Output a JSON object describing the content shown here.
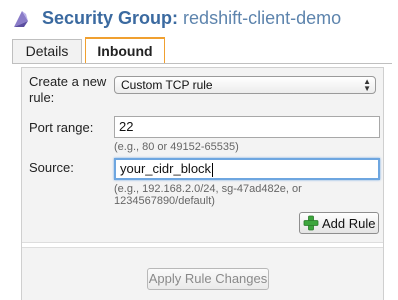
{
  "header": {
    "label": "Security Group:",
    "group_name": "redshift-client-demo",
    "logo_icon": "purple-crystal-icon"
  },
  "tabs": [
    {
      "label": "Details",
      "active": false
    },
    {
      "label": "Inbound",
      "active": true
    }
  ],
  "form": {
    "rule_label": "Create a new rule:",
    "rule_select_value": "Custom TCP rule",
    "port_label": "Port range:",
    "port_value": "22",
    "port_hint": "(e.g., 80 or 49152-65535)",
    "source_label": "Source:",
    "source_value": "your_cidr_block",
    "source_hint": "(e.g., 192.168.2.0/24, sg-47ad482e, or 1234567890/default)",
    "add_rule_label": "Add Rule",
    "add_rule_icon": "green-plus-icon",
    "apply_label": "Apply Rule Changes",
    "apply_enabled": false
  },
  "colors": {
    "title_blue": "#3b6aa0",
    "active_tab_accent": "#f0a030",
    "focus_ring": "#6ea6e0"
  }
}
